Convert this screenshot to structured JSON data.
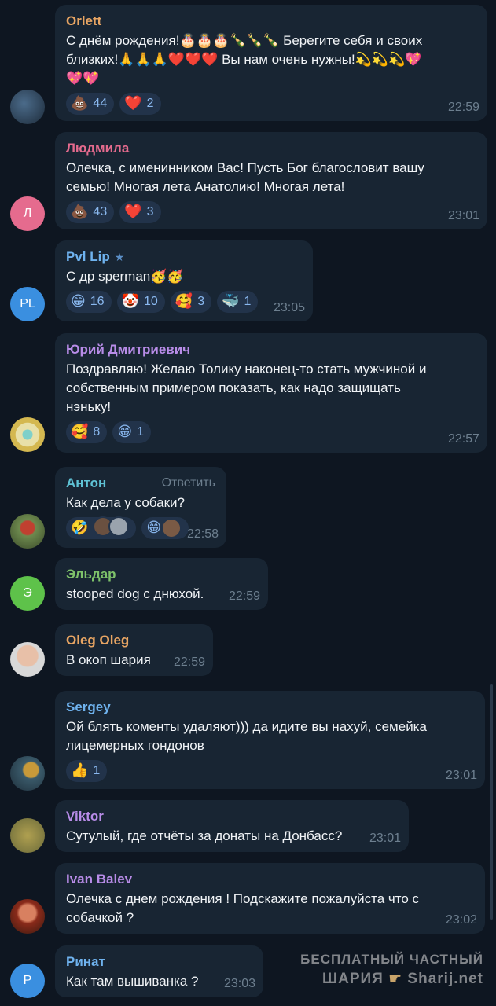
{
  "colors": {
    "background": "#0e1621",
    "bubble": "#182533",
    "reaction_bg": "#22334a",
    "reaction_count": "#8ab8ef",
    "time": "#6d7f8f"
  },
  "messages": [
    {
      "name": "Orlett",
      "name_color": "#e8a563",
      "text": "С днём рождения!🎂🎂🎂🍾🍾🍾 Берегите себя и своих\nблизких!🙏🙏🙏❤️❤️❤️ Вы нам очень нужны!💫💫💫💖\n💖💖",
      "reactions": [
        {
          "icon": "💩",
          "count": "44"
        },
        {
          "icon": "❤️",
          "count": "2"
        }
      ],
      "time": "22:59"
    },
    {
      "name": "Людмила",
      "name_color": "#e56b8e",
      "avatar_letter": "Л",
      "text": "Олечка, с именинником Вас! Пусть Бог благословит вашу\nсемью! Многая лета Анатолию! Многая лета!",
      "reactions": [
        {
          "icon": "💩",
          "count": "43"
        },
        {
          "icon": "❤️",
          "count": "3"
        }
      ],
      "time": "23:01"
    },
    {
      "name": "Pvl Lip",
      "name_color": "#6fb3ef",
      "avatar_letter": "PL",
      "text": "С др sperman🥳🥳",
      "reactions": [
        {
          "icon": "😁",
          "count": "16"
        },
        {
          "icon": "🤡",
          "count": "10"
        },
        {
          "icon": "🥰",
          "count": "3"
        },
        {
          "icon": "🐳",
          "count": "1"
        }
      ],
      "time": "23:05"
    },
    {
      "name": "Юрий Дмитриевич",
      "name_color": "#b88ce8",
      "text": "Поздравляю! Желаю Толику наконец-то стать мужчиной и\nсобственным примером показать, как надо защищать\nнэньку!",
      "reactions": [
        {
          "icon": "🥰",
          "count": "8"
        },
        {
          "icon": "😁",
          "count": "1"
        }
      ],
      "time": "22:57"
    },
    {
      "name": "Антон",
      "name_color": "#5fc3d6",
      "reply_label": "Ответить",
      "text": "Как дела у собаки?",
      "reactions": [
        {
          "icon": "🤣"
        },
        {
          "icon": "😁"
        }
      ],
      "time": "22:58"
    },
    {
      "name": "Эльдар",
      "name_color": "#7ec26a",
      "avatar_letter": "Э",
      "text": "stooped dog с днюхой.",
      "time": "22:59"
    },
    {
      "name": "Oleg Oleg",
      "name_color": "#e8a563",
      "text": "В окоп шария",
      "time": "22:59"
    },
    {
      "name": "Sergey",
      "name_color": "#6fb3ef",
      "text": "Ой блять коменты удаляют))) да идите вы нахуй, семейка\nлицемерных гондонов",
      "reactions": [
        {
          "icon": "👍",
          "count": "1"
        }
      ],
      "time": "23:01"
    },
    {
      "name": "Viktor",
      "name_color": "#b88ce8",
      "text": "Сутулый, где отчёты за донаты на Донбасс?",
      "time": "23:01"
    },
    {
      "name": "Ivan Balev",
      "name_color": "#b88ce8",
      "text": "Олечка с днем рождения ! Подскажите пожалуйста что с\nсобачкой ?",
      "time": "23:02"
    },
    {
      "name": "Ринат",
      "name_color": "#6fb3ef",
      "avatar_letter": "Р",
      "text": "Как там вышиванка ?",
      "time": "23:03"
    }
  ],
  "watermark": {
    "line1": "БЕСПЛАТНЫЙ ЧАСТНЫЙ",
    "line2_a": "ШАРИЯ",
    "line2_b": "Sharij.net"
  }
}
